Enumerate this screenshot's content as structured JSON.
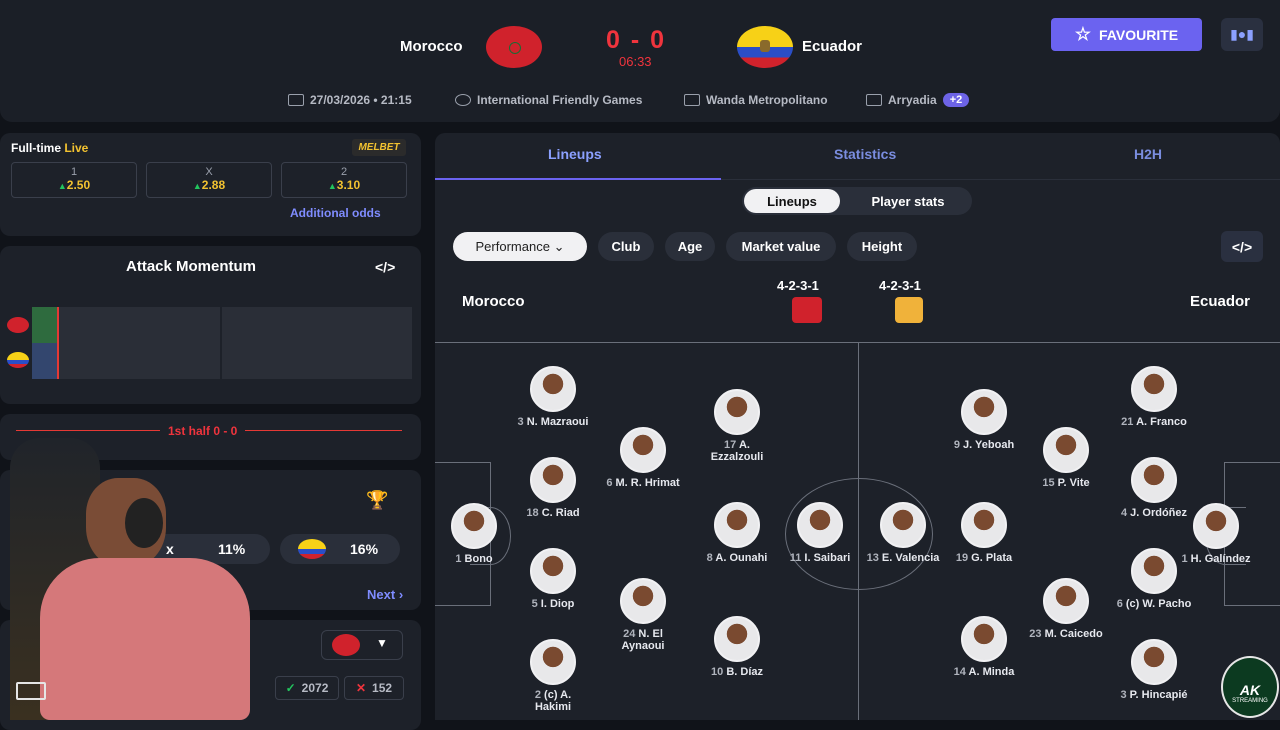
{
  "header": {
    "home_team": "Morocco",
    "away_team": "Ecuador",
    "score": "0 - 0",
    "timer": "06:33",
    "datetime": "27/03/2026 • 21:15",
    "competition": "International Friendly Games",
    "venue": "Wanda Metropolitano",
    "referee": "Arryadia",
    "extra_badge": "+2",
    "favourite_label": "FAVOURITE",
    "favourite_icon": "star-icon",
    "toggle_icon": "layout-toggle-icon"
  },
  "odds": {
    "title": "Full-time",
    "live": "Live",
    "bookmaker": "MELBET",
    "items": [
      {
        "label": "1",
        "value": "2.50"
      },
      {
        "label": "X",
        "value": "2.88"
      },
      {
        "label": "2",
        "value": "3.10"
      }
    ],
    "additional": "Additional odds"
  },
  "momentum": {
    "title": "Attack Momentum",
    "embed_icon": "</>"
  },
  "period": {
    "label": "1st half 0 - 0"
  },
  "vote": {
    "title_partial": "W",
    "draw_label": "x",
    "draw_pct": "11%",
    "away_pct": "16%",
    "next": "Next",
    "trophy_icon": "trophy-icon"
  },
  "bottom": {
    "yes_count": "2072",
    "no_count": "152"
  },
  "tabs": [
    "Lineups",
    "Statistics",
    "H2H"
  ],
  "subtabs": [
    "Lineups",
    "Player stats"
  ],
  "filters": [
    "Performance",
    "Club",
    "Age",
    "Market value",
    "Height"
  ],
  "lineup": {
    "home": "Morocco",
    "away": "Ecuador",
    "home_formation": "4-2-3-1",
    "away_formation": "4-2-3-1",
    "colors": {
      "home_kit": "#d0222c",
      "away_kit": "#f0b23a",
      "accent": "#6b63f0"
    }
  },
  "players": [
    {
      "num": "1",
      "name": "Bono"
    },
    {
      "num": "3",
      "name": "N. Mazraoui"
    },
    {
      "num": "18",
      "name": "C. Riad"
    },
    {
      "num": "5",
      "name": "I. Diop"
    },
    {
      "num": "2",
      "name": "(c) A. Hakimi"
    },
    {
      "num": "6",
      "name": "M. R. Hrimat"
    },
    {
      "num": "24",
      "name": "N. El Aynaoui"
    },
    {
      "num": "17",
      "name": "A. Ezzalzouli"
    },
    {
      "num": "8",
      "name": "A. Ounahi"
    },
    {
      "num": "10",
      "name": "B. Díaz"
    },
    {
      "num": "11",
      "name": "I. Saibari"
    },
    {
      "num": "13",
      "name": "E. Valencia"
    },
    {
      "num": "9",
      "name": "J. Yeboah"
    },
    {
      "num": "19",
      "name": "G. Plata"
    },
    {
      "num": "14",
      "name": "A. Minda"
    },
    {
      "num": "15",
      "name": "P. Vite"
    },
    {
      "num": "23",
      "name": "M. Caicedo"
    },
    {
      "num": "21",
      "name": "A. Franco"
    },
    {
      "num": "4",
      "name": "J. Ordóñez"
    },
    {
      "num": "6",
      "name": "(c) W. Pacho"
    },
    {
      "num": "3",
      "name": "P. Hincapié"
    },
    {
      "num": "1",
      "name": "H. Galíndez"
    }
  ],
  "watermark": {
    "logo": "AK",
    "sub": "STREAMING"
  }
}
